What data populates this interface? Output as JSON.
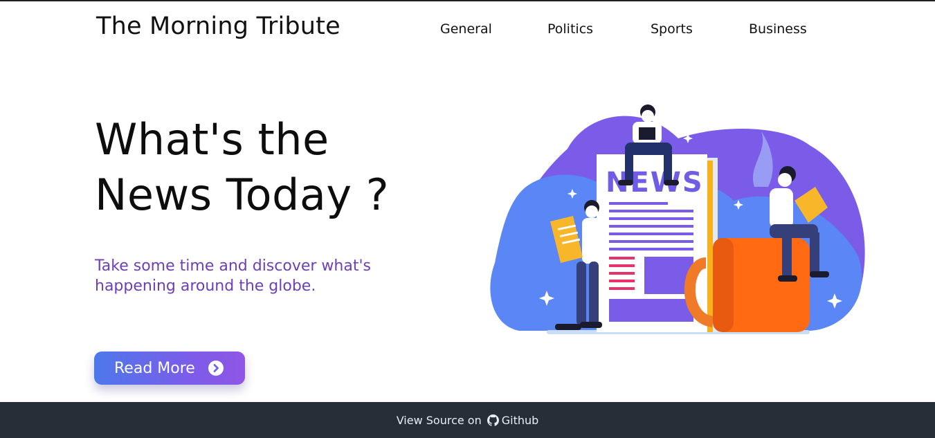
{
  "brand": "The Morning Tribute",
  "nav": {
    "general": "General",
    "politics": "Politics",
    "sports": "Sports",
    "business": "Business"
  },
  "hero": {
    "title_line1": "What's the",
    "title_line2": "News Today ?",
    "subtitle": "Take some time and discover what's happening around the globe.",
    "button_label": "Read More",
    "button_icon": "chevron-circle-right-icon"
  },
  "illustration": {
    "newspaper_text": "NEWS"
  },
  "footer": {
    "text": "View Source on",
    "link_label": "Github",
    "link_icon": "github-icon"
  },
  "colors": {
    "accent_purple": "#6c3fb8",
    "button_start": "#4d78ea",
    "button_end": "#8f55e6",
    "footer_bg": "#262f37",
    "blob_blue": "#5b86f5",
    "blob_purple": "#7b5ce8",
    "mug_orange": "#ff6a13"
  }
}
